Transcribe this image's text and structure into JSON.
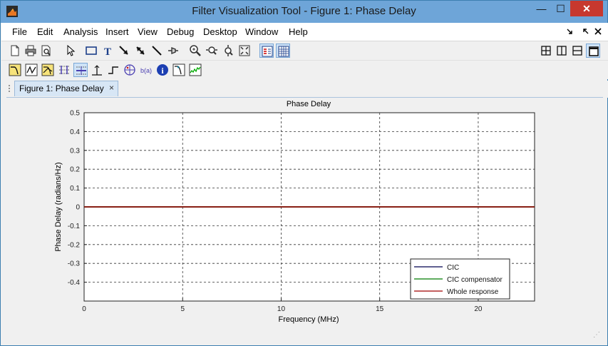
{
  "window": {
    "title": "Filter Visualization Tool - Figure 1: Phase Delay",
    "minimize_symbol": "—",
    "maximize_symbol": "☐",
    "close_symbol": "✕"
  },
  "menus": [
    "File",
    "Edit",
    "Analysis",
    "Insert",
    "View",
    "Debug",
    "Desktop",
    "Window",
    "Help"
  ],
  "menu_right_icons": [
    "undock-arrow-icon",
    "dock-arrow-icon",
    "close-small-icon"
  ],
  "tab": {
    "label": "Figure 1: Phase Delay",
    "close": "×"
  },
  "chart_data": {
    "type": "line",
    "title": "Phase Delay",
    "xlabel": "Frequency (MHz)",
    "ylabel": "Phase Delay (radians/Hz)",
    "xlim": [
      0,
      22.86
    ],
    "ylim": [
      -0.5,
      0.5
    ],
    "xticks": [
      0,
      5,
      10,
      15,
      20
    ],
    "xtick_labels": [
      "0",
      "5",
      "10",
      "15",
      "20"
    ],
    "yticks": [
      -0.4,
      -0.3,
      -0.2,
      -0.1,
      0,
      0.1,
      0.2,
      0.3,
      0.4,
      0.5
    ],
    "ytick_labels": [
      "-0.4",
      "-0.3",
      "-0.2",
      "-0.1",
      "0",
      "0.1",
      "0.2",
      "0.3",
      "0.4",
      "0.5"
    ],
    "grid": true,
    "legend_position": "bottom-right",
    "series": [
      {
        "name": "CIC",
        "color": "#00004f",
        "x": [
          0,
          22.86
        ],
        "y": [
          0,
          0
        ]
      },
      {
        "name": "CIC compensator",
        "color": "#007a00",
        "x": [
          0,
          22.86
        ],
        "y": [
          0,
          0
        ]
      },
      {
        "name": "Whole response",
        "color": "#a00000",
        "x": [
          0,
          22.86
        ],
        "y": [
          0,
          0
        ]
      }
    ]
  }
}
